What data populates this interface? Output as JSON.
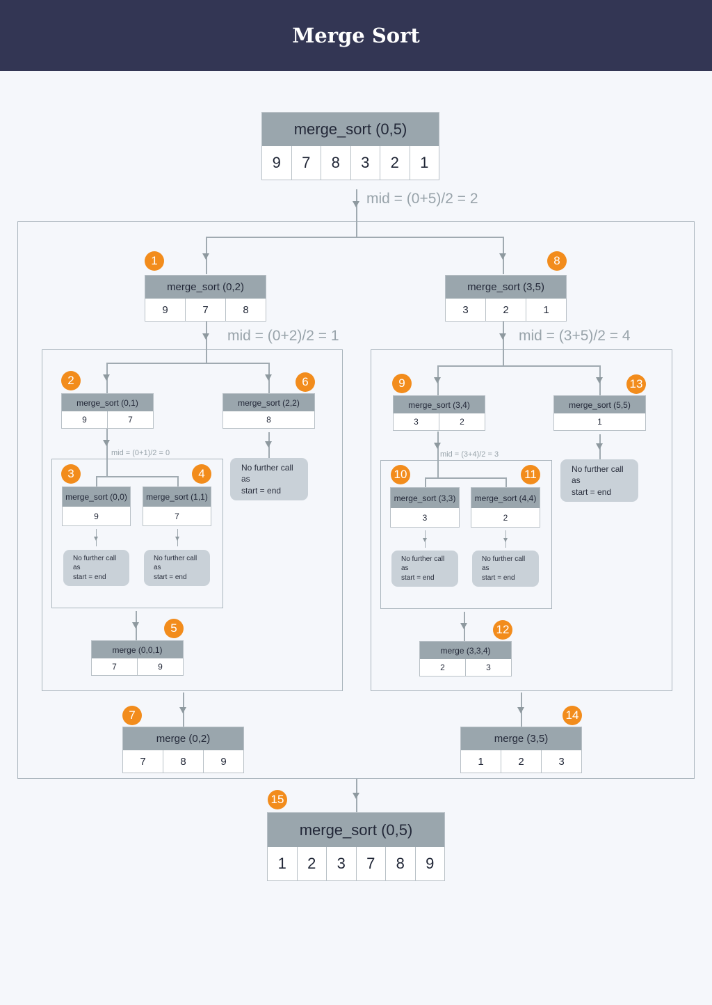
{
  "header": {
    "title": "Merge Sort"
  },
  "colors": {
    "header_bg": "#333654",
    "node_header": "#9aa6ad",
    "badge": "#f28c1c",
    "note_bg": "#c9d1d8",
    "frame": "#a9b4bc"
  },
  "nodes": {
    "ms05": {
      "label": "merge_sort (0,5)",
      "values": [
        "9",
        "7",
        "8",
        "3",
        "2",
        "1"
      ]
    },
    "ms02": {
      "label": "merge_sort (0,2)",
      "values": [
        "9",
        "7",
        "8"
      ],
      "step": "1"
    },
    "ms35": {
      "label": "merge_sort (3,5)",
      "values": [
        "3",
        "2",
        "1"
      ],
      "step": "8"
    },
    "ms01": {
      "label": "merge_sort (0,1)",
      "values": [
        "9",
        "7"
      ],
      "step": "2"
    },
    "ms22": {
      "label": "merge_sort (2,2)",
      "values": [
        "8"
      ],
      "step": "6"
    },
    "ms00": {
      "label": "merge_sort (0,0)",
      "values": [
        "9"
      ],
      "step": "3"
    },
    "ms11": {
      "label": "merge_sort (1,1)",
      "values": [
        "7"
      ],
      "step": "4"
    },
    "m001": {
      "label": "merge (0,0,1)",
      "values": [
        "7",
        "9"
      ],
      "step": "5"
    },
    "m02": {
      "label": "merge (0,2)",
      "values": [
        "7",
        "8",
        "9"
      ],
      "step": "7"
    },
    "ms34": {
      "label": "merge_sort (3,4)",
      "values": [
        "3",
        "2"
      ],
      "step": "9"
    },
    "ms55": {
      "label": "merge_sort (5,5)",
      "values": [
        "1"
      ],
      "step": "13"
    },
    "ms33": {
      "label": "merge_sort (3,3)",
      "values": [
        "3"
      ],
      "step": "10"
    },
    "ms44": {
      "label": "merge_sort (4,4)",
      "values": [
        "2"
      ],
      "step": "11"
    },
    "m334": {
      "label": "merge (3,3,4)",
      "values": [
        "2",
        "3"
      ],
      "step": "12"
    },
    "m35": {
      "label": "merge (3,5)",
      "values": [
        "1",
        "2",
        "3"
      ],
      "step": "14"
    },
    "final": {
      "label": "merge_sort (0,5)",
      "values": [
        "1",
        "2",
        "3",
        "7",
        "8",
        "9"
      ],
      "step": "15"
    }
  },
  "mids": {
    "m05": "mid = (0+5)/2 = 2",
    "m02": "mid = (0+2)/2 = 1",
    "m35": "mid = (3+5)/2 = 4",
    "m01": "mid = (0+1)/2 = 0",
    "m34": "mid = (3+4)/2 = 3"
  },
  "note": {
    "line1": "No further call",
    "line2": "as",
    "line3": "start = end"
  }
}
